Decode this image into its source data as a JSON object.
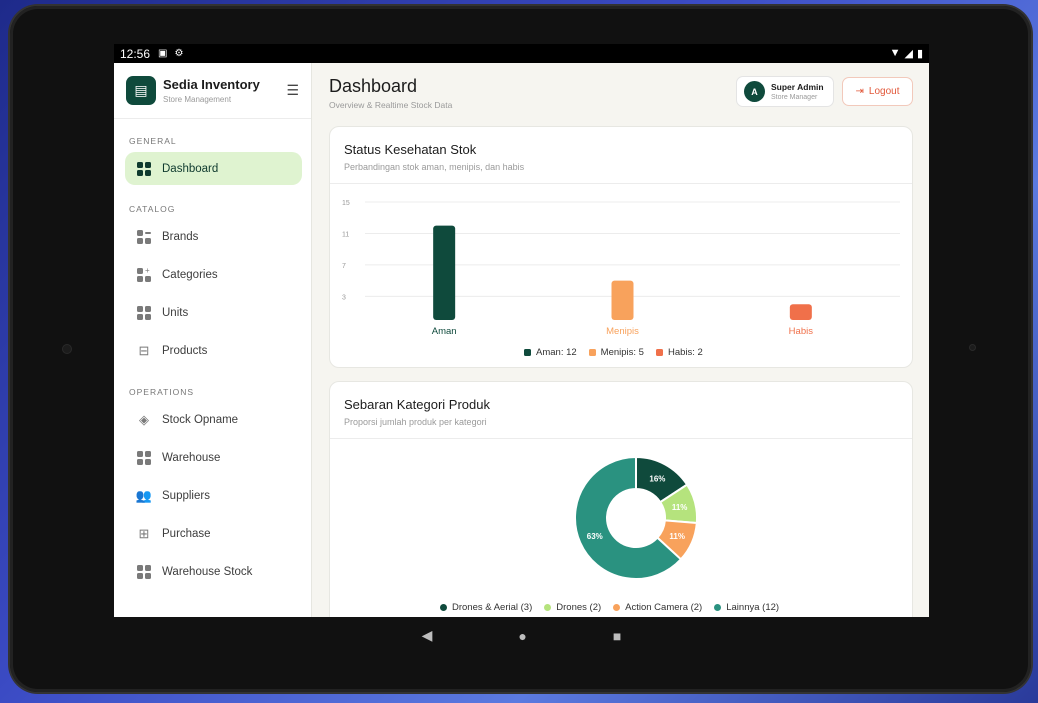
{
  "statusbar": {
    "time": "12:56",
    "icons": [
      "a-icon",
      "settings-icon"
    ],
    "right_icons": [
      "wifi-icon",
      "signal-icon",
      "battery-icon"
    ]
  },
  "sidebar": {
    "brand_name": "Sedia Inventory",
    "brand_sub": "Store Management",
    "sections": {
      "general": "GENERAL",
      "catalog": "CATALOG",
      "operations": "OPERATIONS"
    },
    "items": [
      {
        "label": "Dashboard",
        "icon": "grid-icon",
        "active": true
      },
      {
        "label": "Brands",
        "icon": "grid-minus-icon"
      },
      {
        "label": "Categories",
        "icon": "grid-plus-icon"
      },
      {
        "label": "Units",
        "icon": "grid-icon"
      },
      {
        "label": "Products",
        "icon": "basket-icon"
      },
      {
        "label": "Stock Opname",
        "icon": "layers-icon"
      },
      {
        "label": "Warehouse",
        "icon": "grid-icon"
      },
      {
        "label": "Suppliers",
        "icon": "users-icon"
      },
      {
        "label": "Purchase",
        "icon": "gift-icon"
      },
      {
        "label": "Warehouse Stock",
        "icon": "grid-icon"
      }
    ]
  },
  "header": {
    "title": "Dashboard",
    "subtitle": "Overview & Realtime Stock Data",
    "user": {
      "initial": "A",
      "name": "Super Admin",
      "role": "Store Manager"
    },
    "logout_label": "Logout"
  },
  "stock_card": {
    "title": "Status Kesehatan Stok",
    "subtitle": "Perbandingan stok aman, menipis, dan habis",
    "legend": [
      "Aman: 12",
      "Menipis: 5",
      "Habis: 2"
    ]
  },
  "category_card": {
    "title": "Sebaran Kategori Produk",
    "subtitle": "Proporsi jumlah produk per kategori",
    "legend": [
      "Drones & Aerial (3)",
      "Drones (2)",
      "Action Camera (2)",
      "Lainnya (12)"
    ]
  },
  "colors": {
    "aman": "#0f4a3c",
    "menipis": "#f8a25c",
    "habis": "#f0704a",
    "drones": "#b5e37d",
    "lainnya": "#2a9280",
    "accent": "#0f4a3c"
  },
  "chart_data": [
    {
      "type": "bar",
      "categories": [
        "Aman",
        "Menipis",
        "Habis"
      ],
      "values": [
        12,
        5,
        2
      ],
      "yticks": [
        "3",
        "7",
        "11",
        "15"
      ],
      "ylim": [
        0,
        15
      ],
      "grid": true,
      "legend_position": "bottom"
    },
    {
      "type": "pie",
      "labels": [
        "Drones & Aerial",
        "Drones",
        "Action Camera",
        "Lainnya"
      ],
      "values": [
        3,
        2,
        2,
        12
      ],
      "percent_labels": [
        "16%",
        "11%",
        "11%",
        "63%"
      ],
      "donut": true,
      "legend_position": "bottom"
    }
  ]
}
